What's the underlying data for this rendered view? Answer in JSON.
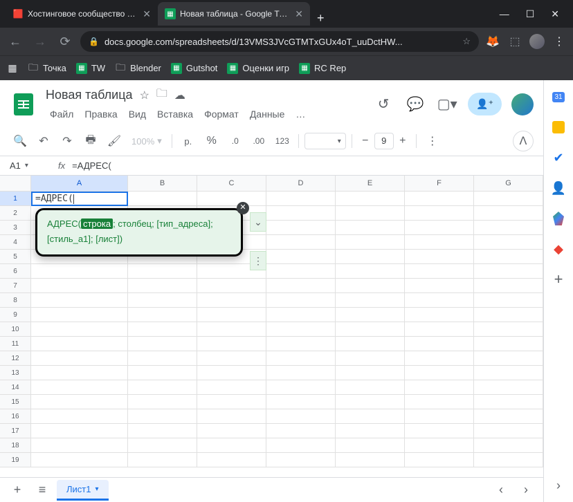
{
  "browser": {
    "tabs": [
      {
        "label": "Хостинговое сообщество «Tim",
        "favicon": "🔴"
      },
      {
        "label": "Новая таблица - Google Табли",
        "favicon": "sheets"
      }
    ],
    "url": "docs.google.com/spreadsheets/d/13VMS3JVcGTMTxGUx4oT_uuDctHW...",
    "bookmarks": [
      {
        "label": "Точка",
        "icon": "folder"
      },
      {
        "label": "TW",
        "icon": "sheets"
      },
      {
        "label": "Blender",
        "icon": "folder"
      },
      {
        "label": "Gutshot",
        "icon": "sheets"
      },
      {
        "label": "Оценки игр",
        "icon": "sheets"
      },
      {
        "label": "RC Rep",
        "icon": "sheets"
      }
    ]
  },
  "doc": {
    "title": "Новая таблица",
    "menus": [
      "Файл",
      "Правка",
      "Вид",
      "Вставка",
      "Формат",
      "Данные"
    ],
    "zoom": "100%",
    "currency": "р.",
    "fontsize": "9",
    "nf123": "123"
  },
  "namebox": "A1",
  "formula": "=АДРЕС(",
  "cell_value": "=АДРЕС(",
  "columns": [
    "A",
    "B",
    "C",
    "D",
    "E",
    "F",
    "G"
  ],
  "rows": [
    "1",
    "2",
    "3",
    "4",
    "5",
    "6",
    "7",
    "8",
    "9",
    "10",
    "11",
    "12",
    "13",
    "14",
    "15",
    "16",
    "17",
    "18",
    "19"
  ],
  "tooltip": {
    "fn": "АДРЕС(",
    "arg_active": "строка",
    "rest1": "; столбец; [тип_адреса];",
    "rest2": "[стиль_a1]; [лист])"
  },
  "sheet_tab": "Лист1",
  "sidepanel_cal": "31"
}
